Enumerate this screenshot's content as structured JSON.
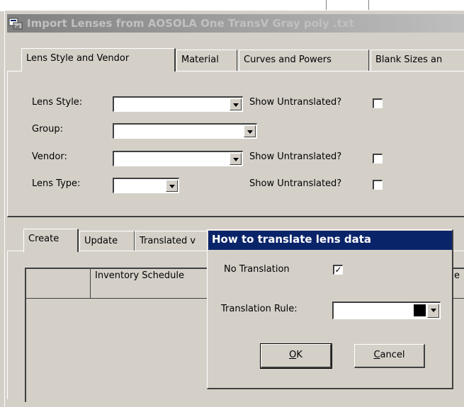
{
  "window": {
    "title": "Import Lenses from AOSOLA One TransV Gray poly .txt"
  },
  "top_tabs": [
    {
      "label": "Lens Style and Vendor",
      "active": true
    },
    {
      "label": "Material"
    },
    {
      "label": "Curves and Powers"
    },
    {
      "label": "Blank Sizes an"
    }
  ],
  "form": {
    "lens_style_label": "Lens Style:",
    "group_label": "Group:",
    "vendor_label": "Vendor:",
    "lens_type_label": "Lens Type:",
    "show_untranslated": "Show Untranslated?"
  },
  "bottom_tabs": [
    {
      "label": "Create",
      "active": true
    },
    {
      "label": "Update"
    },
    {
      "label": "Translated v"
    }
  ],
  "grid": {
    "columns": [
      "",
      "Inventory Schedule",
      "e"
    ]
  },
  "dialog": {
    "title": "How to translate lens data",
    "no_translation_label": "No Translation",
    "no_translation_checked": true,
    "checkmark": "✓",
    "translation_rule_label": "Translation Rule:",
    "ok_label": "OK",
    "ok_underline": "O",
    "ok_rest": "K",
    "cancel_label": "Cancel",
    "cancel_underline": "C",
    "cancel_rest": "ancel"
  }
}
